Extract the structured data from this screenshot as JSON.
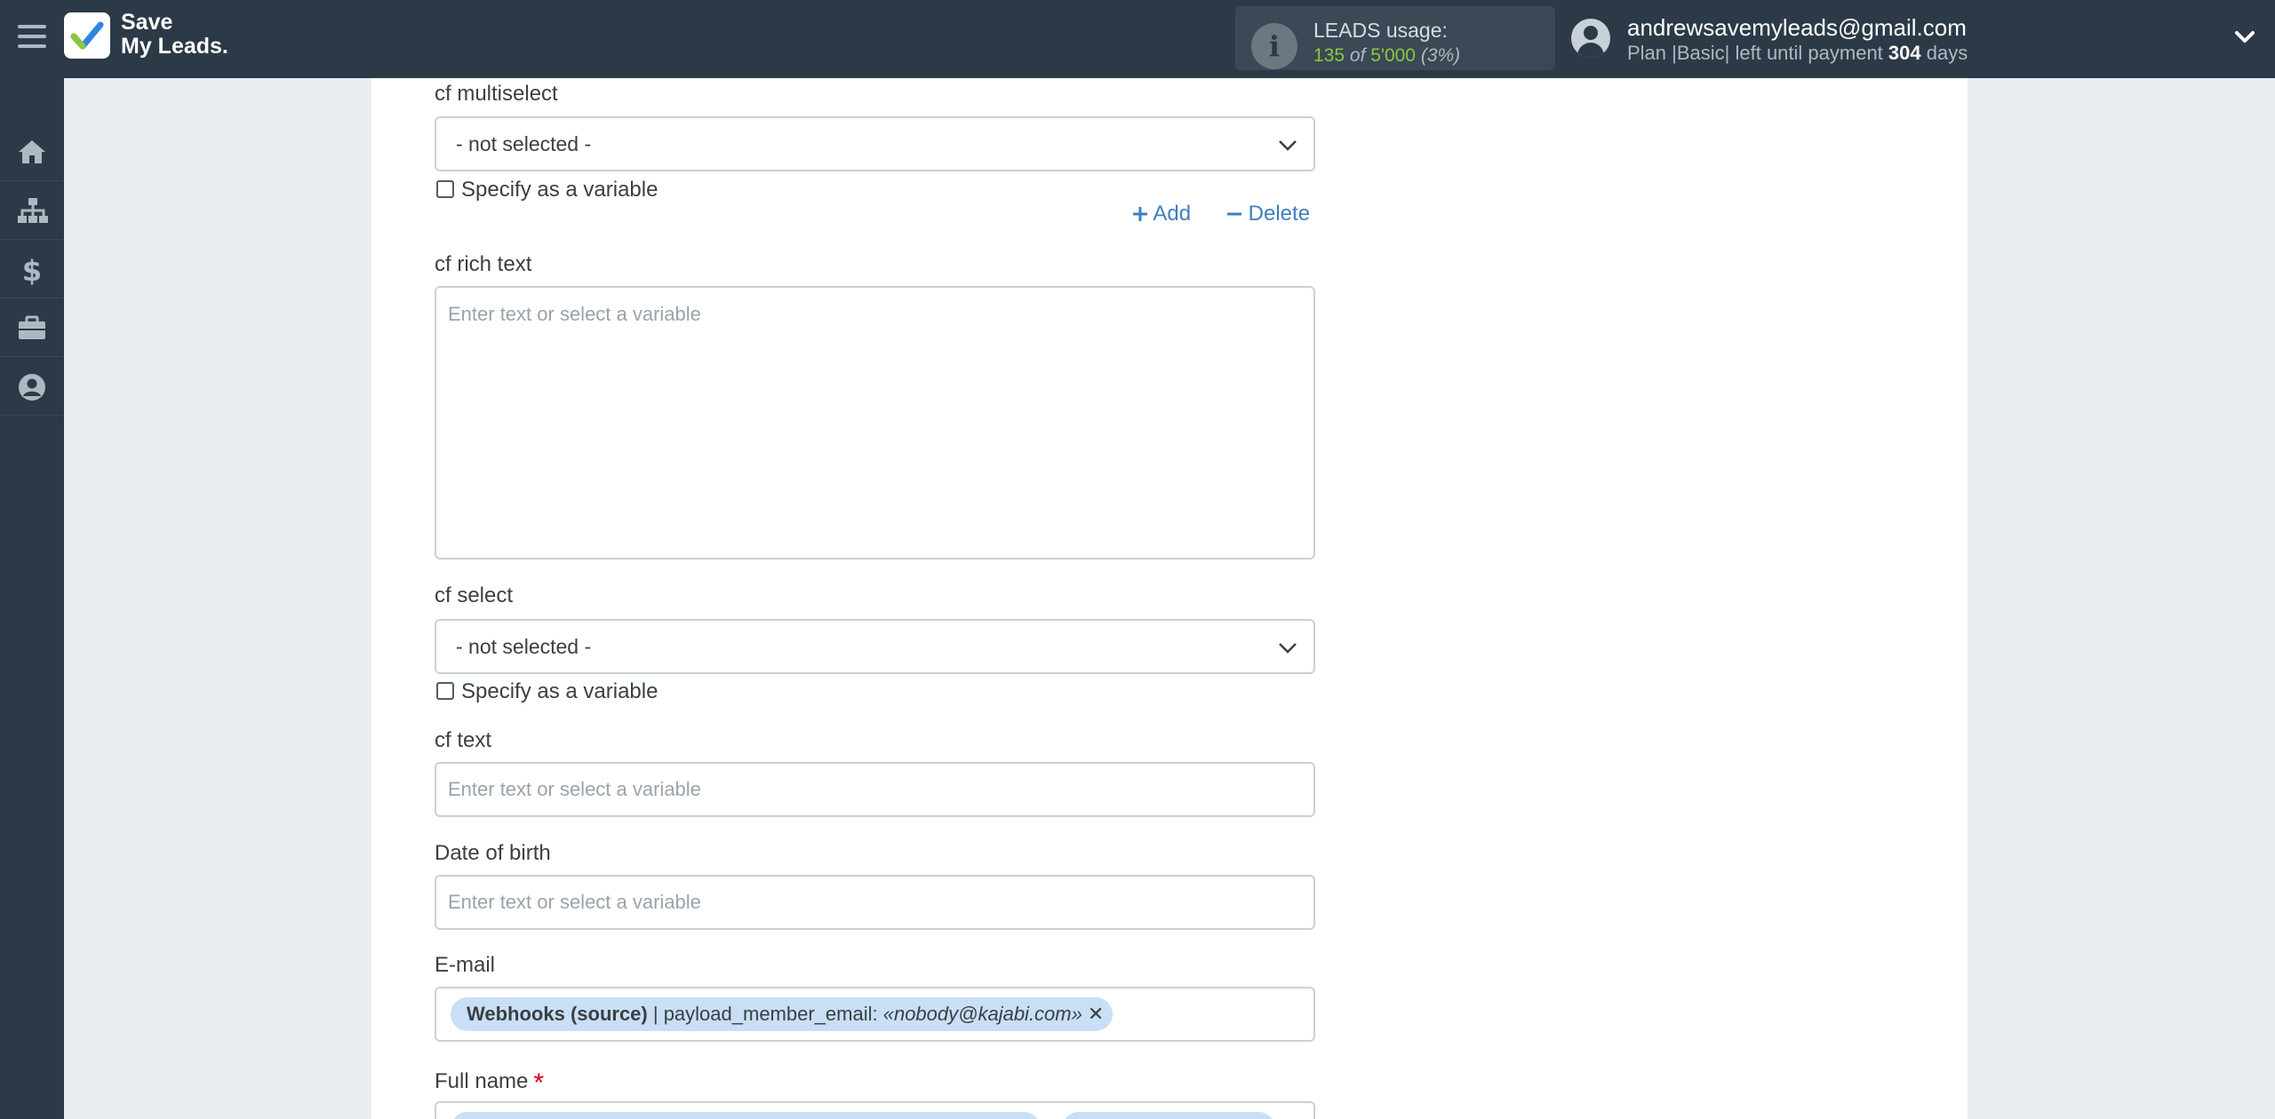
{
  "header": {
    "logo_line1": "Save",
    "logo_line2": "My Leads.",
    "usage_title": "LEADS usage:",
    "usage_used": "135",
    "usage_of": "of",
    "usage_total": "5'000",
    "usage_percent": "(3%)",
    "account_email": "andrewsavemyleads@gmail.com",
    "plan_prefix": "Plan |Basic| left until payment",
    "plan_days": "304",
    "plan_suffix": "days"
  },
  "sidebar": {
    "items": [
      {
        "icon": "home-icon"
      },
      {
        "icon": "sitemap-icon"
      },
      {
        "icon": "dollar-icon"
      },
      {
        "icon": "briefcase-icon"
      },
      {
        "icon": "user-icon"
      }
    ]
  },
  "form": {
    "multiselect": {
      "label": "cf multiselect",
      "value": "- not selected -",
      "checkbox_label": "Specify as a variable",
      "add_label": "Add",
      "delete_label": "Delete"
    },
    "rich_text": {
      "label": "cf rich text",
      "placeholder": "Enter text or select a variable"
    },
    "select": {
      "label": "cf select",
      "value": "- not selected -",
      "checkbox_label": "Specify as a variable"
    },
    "text": {
      "label": "cf text",
      "placeholder": "Enter text or select a variable"
    },
    "dob": {
      "label": "Date of birth",
      "placeholder": "Enter text or select a variable"
    },
    "email": {
      "label": "E-mail",
      "chip_source": "Webhooks (source)",
      "chip_field": " | payload_member_email: ",
      "chip_value": "«nobody@kajabi.com»",
      "chip_remove": "✕"
    },
    "full_name": {
      "label": "Full name",
      "required_mark": "*"
    }
  }
}
